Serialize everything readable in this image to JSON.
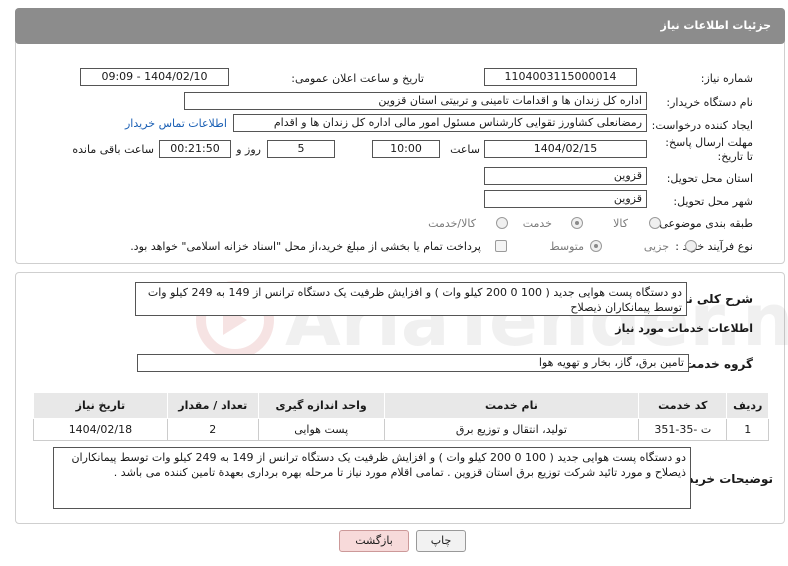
{
  "header": {
    "title": "جزئیات اطلاعات نیاز"
  },
  "need_number": {
    "label": "شماره نیاز:",
    "value": "1104003115000014"
  },
  "announce_datetime": {
    "label": "تاریخ و ساعت اعلان عمومی:",
    "value": "1404/02/10 - 09:09"
  },
  "buyer_org": {
    "label": "نام دستگاه خریدار:",
    "value": "اداره کل زندان ها و اقدامات تامینی و تربیتی استان قزوین"
  },
  "requester": {
    "label": "ایجاد کننده درخواست:",
    "value": "رمضانعلی کشاورز تقوایی کارشناس مسئول امور مالی  اداره کل زندان ها و اقدام",
    "contact_link": "اطلاعات تماس خریدار"
  },
  "deadline": {
    "label": "مهلت ارسال پاسخ: تا تاریخ:",
    "date": "1404/02/15",
    "time_label": "ساعت",
    "time": "10:00",
    "days": "5",
    "days_label": "روز و",
    "remaining": "00:21:50",
    "remaining_label": "ساعت باقی مانده"
  },
  "delivery_province": {
    "label": "استان محل تحویل:",
    "value": "قزوین"
  },
  "delivery_city": {
    "label": "شهر محل تحویل:",
    "value": "قزوین"
  },
  "category": {
    "label": "طبقه بندی موضوعی:",
    "options": [
      "کالا",
      "خدمت",
      "کالا/خدمت"
    ],
    "selected": "خدمت"
  },
  "purchase_type": {
    "label": "نوع فرآیند خرید :",
    "options": [
      "جزیی",
      "متوسط"
    ],
    "selected": "متوسط",
    "payment_note": "پرداخت تمام یا بخشی از مبلغ خرید،از محل \"اسناد خزانه اسلامی\" خواهد بود."
  },
  "general_description": {
    "label": "شرح کلی نیاز:",
    "value": "دو دستگاه پست هوایی جدید ( 100 0 200 کیلو وات ) و افزایش ظرفیت یک دستگاه ترانس از 149 به 249 کیلو وات توسط پیمانکاران ذیصلاح"
  },
  "services_info": {
    "title": "اطلاعات خدمات مورد نیاز"
  },
  "service_group": {
    "label": "گروه خدمت:",
    "value": "تامین برق، گاز، بخار و تهویه هوا"
  },
  "services_table": {
    "headers": [
      "ردیف",
      "کد خدمت",
      "نام خدمت",
      "واحد اندازه گیری",
      "تعداد / مقدار",
      "تاریخ نیاز"
    ],
    "rows": [
      [
        "1",
        "ت -35-351",
        "تولید، انتقال و توزیع برق",
        "پست هوایی",
        "2",
        "1404/02/18"
      ]
    ]
  },
  "buyer_notes": {
    "label": "توضیحات خریدار:",
    "value": "دو دستگاه پست هوایی جدید ( 100 0 200 کیلو وات ) و افزایش ظرفیت یک دستگاه ترانس از 149 به 249 کیلو وات توسط پیمانکاران ذیصلاح و مورد تائید شرکت توزیع برق استان قزوین . تمامی اقلام مورد نیاز تا مرحله بهره برداری بعهدة تامین کننده می باشد ."
  },
  "buttons": {
    "print": "چاپ",
    "back": "بازگشت"
  },
  "watermark": {
    "text": "AriaTender.neT"
  }
}
